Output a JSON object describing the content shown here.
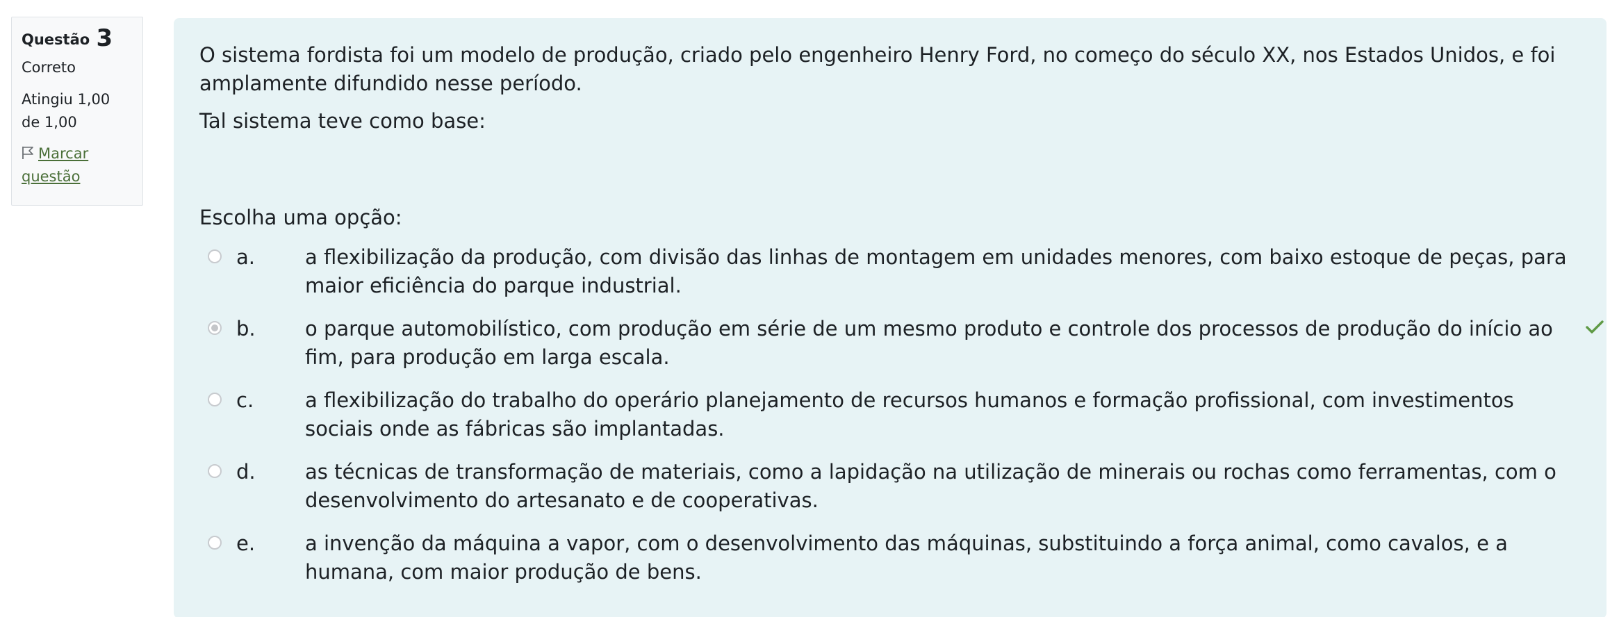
{
  "info": {
    "question_label": "Questão",
    "question_number": "3",
    "state": "Correto",
    "grade": "Atingiu 1,00 de 1,00",
    "flag_label": "Marcar questão"
  },
  "question": {
    "paragraph_1": "O sistema fordista foi um modelo de produção, criado pelo engenheiro Henry Ford, no começo do século XX, nos Estados Unidos, e foi amplamente difundido nesse período.",
    "paragraph_2": "Tal sistema teve como base:",
    "prompt": "Escolha uma opção:"
  },
  "options": [
    {
      "letter": "a.",
      "text": "a flexibilização da produção, com divisão das linhas de montagem em unidades menores, com baixo estoque de peças, para maior eficiência do parque industrial.",
      "selected": false,
      "correct": false
    },
    {
      "letter": "b.",
      "text": "o parque automobilístico, com produção em série de um mesmo produto e controle dos processos de produção do início ao fim, para produção em larga escala.",
      "selected": true,
      "correct": true
    },
    {
      "letter": "c.",
      "text": "a flexibilização do trabalho do operário planejamento de recursos humanos e formação profissional, com investimentos sociais onde as fábricas são implantadas.",
      "selected": false,
      "correct": false
    },
    {
      "letter": "d.",
      "text": "as técnicas de transformação de materiais, como a lapidação na utilização de minerais ou rochas como ferramentas, com o desenvolvimento do artesanato e de cooperativas.",
      "selected": false,
      "correct": false
    },
    {
      "letter": "e.",
      "text": "a invenção da máquina a vapor, com o desenvolvimento das máquinas, substituindo a força animal, como cavalos, e a humana, com maior produção de bens.",
      "selected": false,
      "correct": false
    }
  ],
  "colors": {
    "formulation_bg": "#e7f3f5",
    "info_bg": "#f8f9fa",
    "correct_check": "#5f9a45",
    "flag_link": "#4a6f38"
  },
  "icons": {
    "flag": "flag-icon",
    "correct": "check-icon"
  }
}
